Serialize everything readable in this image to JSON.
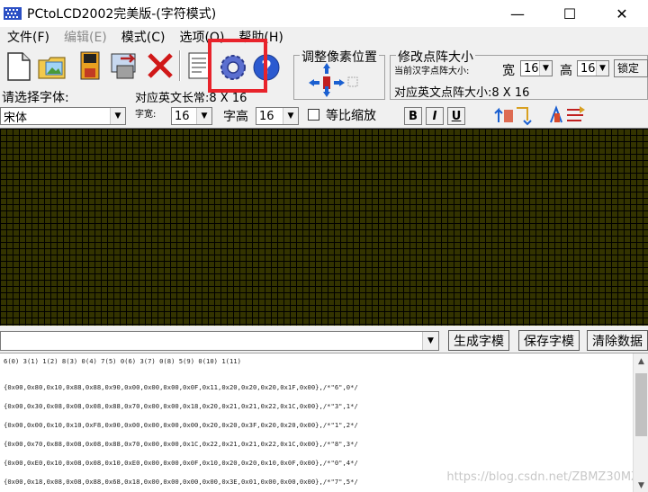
{
  "window": {
    "title": "PCtoLCD2002完美版-(字符模式)",
    "minimize": "—",
    "maximize": "☐",
    "close": "✕"
  },
  "menu": [
    "文件(F)",
    "编辑(E)",
    "模式(C)",
    "选项(O)",
    "帮助(H)"
  ],
  "toolbar": {
    "icons": [
      "new-file-icon",
      "open-image-icon",
      "save-icon",
      "export-icon",
      "delete-icon",
      "notepad-icon",
      "settings-gear-icon",
      "help-icon"
    ]
  },
  "font_panel": {
    "select_font_label": "请选择字体:",
    "font_name": "宋体",
    "en_size_label": "对应英文长常:8 X 16",
    "zi_kuan_label": "字宽:",
    "zi_kuan_value": "16",
    "zi_gao_label": "字高",
    "zi_gao_value": "16",
    "proportional_label": "等比缩放"
  },
  "pixel_panel": {
    "title": "调整像素位置"
  },
  "matrix_panel": {
    "title": "修改点阵大小",
    "current_label": "当前汉字点阵大小:",
    "width_label": "宽",
    "width_value": "16",
    "height_label": "高",
    "height_value": "16",
    "lock_label": "锁定",
    "en_matrix_label": "对应英文点阵大小:8 X 16"
  },
  "format_buttons": [
    "B",
    "I",
    "U"
  ],
  "actions": {
    "generate": "生成字模",
    "save": "保存字模",
    "clear": "清除数据"
  },
  "output": {
    "index_line": "6(0) 3(1) 1(2) 8(3) 0(4) 7(5) 0(6) 3(7) 0(8) 5(9) 0(10) 1(11)",
    "lines": [
      "{0x00,0x80,0x10,0x88,0x88,0x90,0x00,0x00,0x00,0x0F,0x11,0x20,0x20,0x20,0x1F,0x00},/*\"6\",0*/",
      "{0x00,0x30,0x08,0x08,0x08,0x88,0x70,0x00,0x00,0x18,0x20,0x21,0x21,0x22,0x1C,0x00},/*\"3\",1*/",
      "{0x00,0x00,0x10,0x10,0xF8,0x00,0x00,0x00,0x00,0x00,0x20,0x20,0x3F,0x20,0x20,0x00},/*\"1\",2*/",
      "{0x00,0x70,0x88,0x08,0x08,0x88,0x70,0x00,0x00,0x1C,0x22,0x21,0x21,0x22,0x1C,0x00},/*\"8\",3*/",
      "{0x00,0xE0,0x10,0x08,0x08,0x10,0xE0,0x00,0x00,0x0F,0x10,0x20,0x20,0x10,0x0F,0x00},/*\"0\",4*/",
      "{0x00,0x18,0x08,0x08,0x88,0x68,0x18,0x00,0x00,0x00,0x00,0x3E,0x01,0x00,0x00,0x00},/*\"7\",5*/"
    ],
    "watermark": "https://blog.csdn.net/ZBMZ30MZ"
  }
}
